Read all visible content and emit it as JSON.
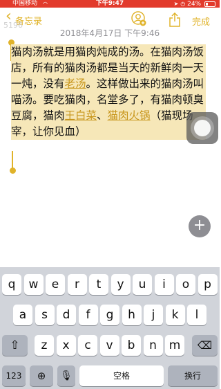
{
  "status_bar": {
    "carrier": "中国移动",
    "time": "下午9:47",
    "battery": "24%",
    "battery_level": 0.24
  },
  "navbar": {
    "back_label": "备忘录",
    "done_label": "完成"
  },
  "watermark": "5196",
  "note": {
    "date": "2018年4月17日 下午9:46",
    "segments": [
      {
        "text": "猫肉汤就是用猫肉炖成的汤。在猫肉汤饭店，所有的猫肉汤都是当天的新鲜肉一天一炖，没有",
        "link": false
      },
      {
        "text": "老汤",
        "link": true
      },
      {
        "text": "。这样做出来的猫肉汤叫喵汤。要吃猫肉，名堂多了，有猫肉顿臭豆腐，猫肉",
        "link": false
      },
      {
        "text": "王白菜",
        "link": true
      },
      {
        "text": "、",
        "link": false
      },
      {
        "text": "猫肉火锅",
        "link": true
      },
      {
        "text": "（猫现场宰，让你见血）",
        "link": false
      }
    ]
  },
  "plus_button": "+",
  "keyboard": {
    "row1": [
      "q",
      "w",
      "e",
      "r",
      "t",
      "y",
      "u",
      "i",
      "o",
      "p"
    ],
    "row2": [
      "a",
      "s",
      "d",
      "f",
      "g",
      "h",
      "j",
      "k",
      "l"
    ],
    "row3": [
      "z",
      "x",
      "c",
      "v",
      "b",
      "n",
      "m"
    ],
    "numbers_key": "123",
    "space_key": "空格",
    "return_key": "换行"
  },
  "colors": {
    "accent": "#e0b32a",
    "selection": "#f6e7b8",
    "status_bar": "#e23a2c"
  }
}
